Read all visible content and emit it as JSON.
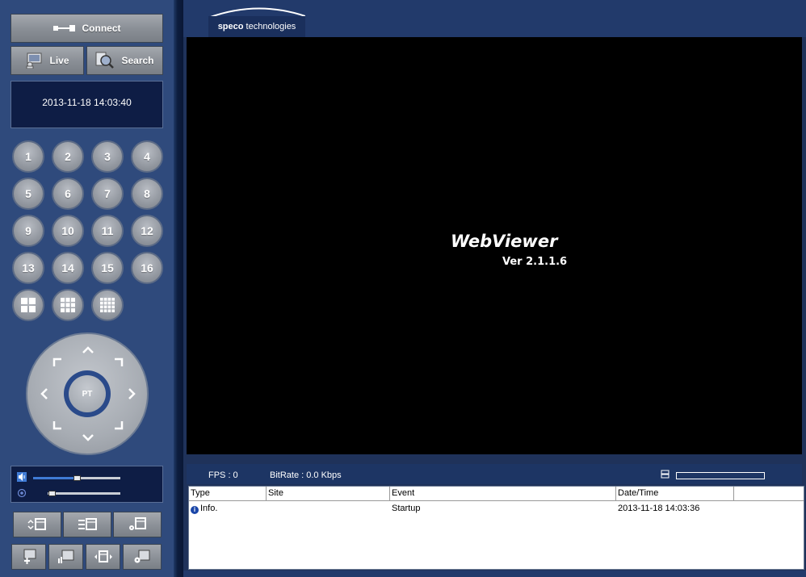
{
  "sidebar": {
    "connect_label": "Connect",
    "live_label": "Live",
    "search_label": "Search",
    "datetime": "2013-11-18 14:03:40",
    "channels": [
      "1",
      "2",
      "3",
      "4",
      "5",
      "6",
      "7",
      "8",
      "9",
      "10",
      "11",
      "12",
      "13",
      "14",
      "15",
      "16"
    ],
    "layouts": [
      "layout-2x2-icon",
      "layout-3x3-icon",
      "layout-4x4-icon"
    ],
    "ptz_center_label": "PT",
    "volume_level": 0.5,
    "mic_level": 0.05
  },
  "header": {
    "brand_bold": "speco",
    "brand_rest": " technologies"
  },
  "video": {
    "title": "WebViewer",
    "version": "Ver 2.1.1.6"
  },
  "status": {
    "fps": "FPS :  0",
    "bitrate": "BitRate :  0.0 Kbps",
    "hdd_usage": 0
  },
  "log": {
    "columns": [
      "Type",
      "Site",
      "Event",
      "Date/Time"
    ],
    "rows": [
      {
        "type": "Info.",
        "site": "",
        "event": "Startup",
        "datetime": "2013-11-18 14:03:36"
      }
    ]
  },
  "colors": {
    "panel": "#2f4a7c",
    "background": "#1f325a",
    "accent": "#3f7bd6"
  }
}
